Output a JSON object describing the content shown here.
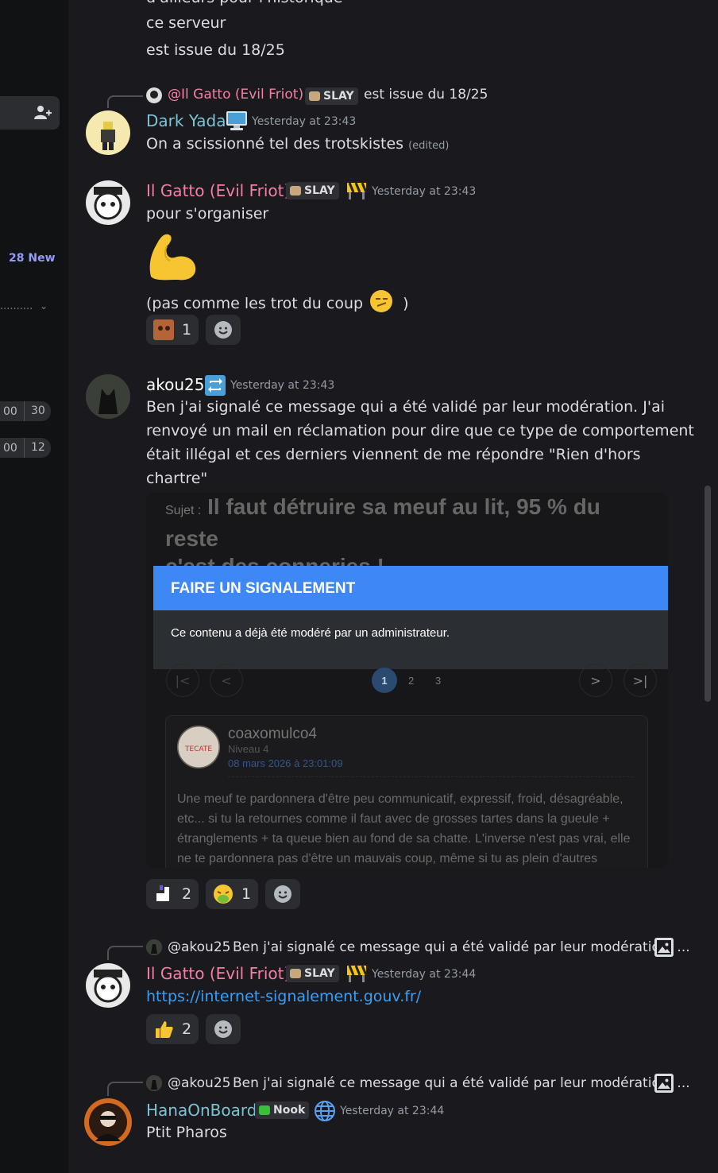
{
  "sidebar": {
    "new_label": "28 New",
    "dots": "..........",
    "pills": [
      {
        "a": "00",
        "b": "30"
      },
      {
        "a": "00",
        "b": "12"
      }
    ]
  },
  "top": {
    "line0": "d'ailleurs pour l'historique",
    "line1": "ce serveur",
    "line2": "est issue du 18/25"
  },
  "m1": {
    "reply_name": "@Il Gatto (Evil Friot)",
    "reply_tag": "SLAY",
    "reply_text": "est issue du 18/25",
    "author": "Dark Yada",
    "time": "Yesterday at 23:43",
    "text": "On a scissionné tel des trotskistes",
    "edited": "(edited)"
  },
  "m2": {
    "author": "Il Gatto (Evil Friot)",
    "tag": "SLAY",
    "time": "Yesterday at 23:43",
    "text1": "pour s'organiser",
    "text2": "(pas comme les trot du coup",
    "text2_end": ")",
    "react1_count": "1"
  },
  "m3": {
    "author": "akou25",
    "time": "Yesterday at 23:43",
    "lines": [
      "Ben j'ai signalé ce message qui a été validé par leur modération. J'ai",
      "renvoyé un mail en réclamation pour dire que ce type de comportement",
      "était illégal et ces derniers viennent de me répondre \"Rien d'hors",
      "chartre\""
    ],
    "embed": {
      "subject_label": "Sujet :",
      "subject_line1": "Il faut détruire sa meuf au lit, 95 % du reste",
      "subject_line2": "c'est des conneries !",
      "modal_title": "FAIRE UN SIGNALEMENT",
      "modal_text": "Ce contenu a déjà été modéré par un administrateur.",
      "pages": [
        "1",
        "2",
        "3"
      ],
      "post_user": "coaxomulco4",
      "post_level": "Niveau 4",
      "post_date": "08 mars 2026 à 23:01:09",
      "avatar_text": "TECATE",
      "post_body": "Une meuf te pardonnera d'être peu communicatif, expressif, froid, désagréable, etc... si tu la retournes comme il faut avec de grosses tartes dans la gueule + étranglements + ta queue bien au fond de sa chatte. L'inverse n'est pas vrai, elle ne te pardonnera pas d'être un mauvais coup, même si tu as plein d'autres"
    },
    "react1_count": "2",
    "react2_count": "1"
  },
  "m4": {
    "reply_name": "@akou25",
    "reply_text": "Ben j'ai signalé ce message qui a été validé par leur modération. ...",
    "author": "Il Gatto (Evil Friot)",
    "tag": "SLAY",
    "time": "Yesterday at 23:44",
    "link": "https://internet-signalement.gouv.fr/",
    "react1_count": "2"
  },
  "m5": {
    "reply_name": "@akou25",
    "reply_text": "Ben j'ai signalé ce message qui a été validé par leur modération. ...",
    "author": "HanaOnBoard",
    "tag": "Nook",
    "time": "Yesterday at 23:44",
    "text": "Ptit Pharos"
  },
  "colors": {
    "pink_name": "#f47fa5",
    "teal_name": "#7ec3d4",
    "link": "#3a9ef5",
    "accent": "#949cf7"
  }
}
